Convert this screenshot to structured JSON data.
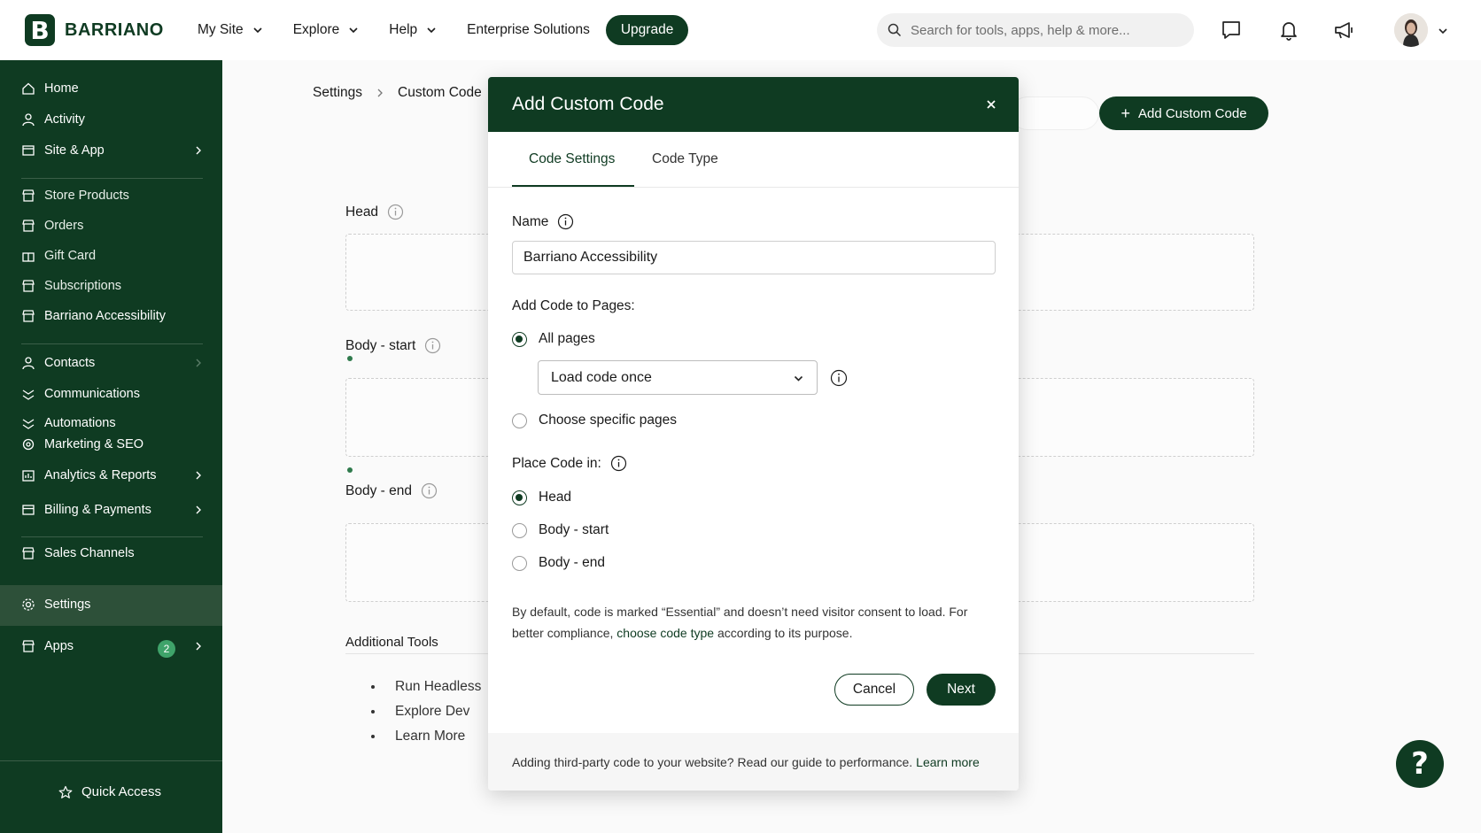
{
  "brand": {
    "logo_letter": "B",
    "name": "BARRIANO",
    "color": "#0f3b22"
  },
  "topnav": {
    "items": [
      {
        "label": "My Site",
        "has_menu": true
      },
      {
        "label": "Explore",
        "has_menu": true
      },
      {
        "label": "Help",
        "has_menu": true
      },
      {
        "label": "Enterprise Solutions",
        "has_menu": false
      }
    ],
    "upgrade_label": "Upgrade",
    "search_placeholder": "Search for tools, apps, help & more...",
    "icons": [
      "chat-icon",
      "bell-icon",
      "megaphone-icon",
      "avatar",
      "chevron-down-icon"
    ]
  },
  "sidebar": {
    "items": [
      {
        "label": "Home",
        "icon": "home-icon"
      },
      {
        "label": "Activity",
        "icon": "activity-icon"
      },
      {
        "label": "Site & App",
        "icon": "site-icon",
        "has_arrow": true
      },
      {
        "label": "Store Products",
        "icon": "store-icon"
      },
      {
        "label": "Orders",
        "icon": "orders-icon"
      },
      {
        "label": "Gift Card",
        "icon": "gift-icon"
      },
      {
        "label": "Subscriptions",
        "icon": "subscriptions-icon"
      },
      {
        "label": "Barriano Accessibility",
        "icon": "accessibility-icon"
      },
      {
        "label": "Contacts",
        "icon": "contacts-icon",
        "has_arrow": true
      },
      {
        "label": "Communications",
        "icon": "communications-icon"
      },
      {
        "label": "Automations",
        "icon": "automations-icon"
      },
      {
        "label": "Marketing & SEO",
        "icon": "marketing-icon"
      },
      {
        "label": "Analytics & Reports",
        "icon": "analytics-icon",
        "has_arrow": true
      },
      {
        "label": "Billing & Payments",
        "icon": "billing-icon",
        "has_arrow": true
      },
      {
        "label": "Sales Channels",
        "icon": "sales-icon"
      },
      {
        "label": "Settings",
        "icon": "gear-icon",
        "active": true
      },
      {
        "label": "Apps",
        "icon": "apps-icon",
        "badge": "2",
        "has_arrow": true
      }
    ],
    "quick_access_label": "Quick Access"
  },
  "main": {
    "breadcrumb": [
      "Settings",
      "Custom Code"
    ],
    "add_button_label": "Add Custom Code",
    "sections": [
      {
        "label": "Head"
      },
      {
        "label": "Body - start"
      },
      {
        "label": "Body - end"
      }
    ],
    "additional_tools": {
      "title": "Additional Tools",
      "items": [
        "Run Headless",
        "Explore Dev",
        "Learn More"
      ]
    }
  },
  "modal": {
    "title": "Add Custom Code",
    "tabs": [
      {
        "label": "Code Settings",
        "active": true
      },
      {
        "label": "Code Type",
        "active": false
      }
    ],
    "name_label": "Name",
    "name_value": "Barriano Accessibility",
    "pages_label": "Add Code to Pages:",
    "pages_options": [
      {
        "label": "All pages",
        "selected": true
      },
      {
        "label": "Choose specific pages",
        "selected": false
      }
    ],
    "load_select_value": "Load code once",
    "place_label": "Place Code in:",
    "place_options": [
      {
        "label": "Head",
        "selected": true
      },
      {
        "label": "Body - start",
        "selected": false
      },
      {
        "label": "Body - end",
        "selected": false
      }
    ],
    "note_part1": "By default, code is marked “Essential” and doesn’t need visitor consent to load. For better compliance,",
    "note_link": "choose code type",
    "note_part2": "according to its purpose.",
    "cancel_label": "Cancel",
    "next_label": "Next",
    "footer_text": "Adding third-party code to your website? Read our guide to performance.",
    "footer_link": "Learn more"
  },
  "help_fab_label": "?"
}
